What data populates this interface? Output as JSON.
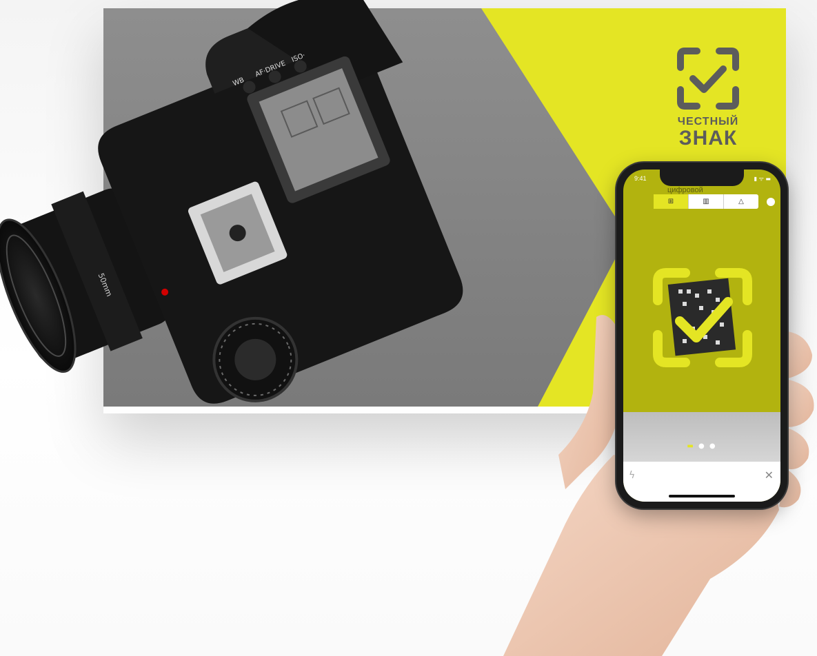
{
  "logo": {
    "line1": "ЧЕСТНЫЙ",
    "line2": "ЗНАК"
  },
  "camera": {
    "wb_label": "WB",
    "af_label": "AF·DRIVE",
    "iso_label": "ISO·",
    "lens_label": "50mm"
  },
  "phone": {
    "status_time": "9:41",
    "status_icons": "▮ ᯤ ▬",
    "screen_label": "цифровой",
    "segments": [
      {
        "icon": "datamatrix-icon",
        "glyph": "⊞"
      },
      {
        "icon": "barcode-icon",
        "glyph": "▥"
      },
      {
        "icon": "warning-icon",
        "glyph": "△"
      }
    ],
    "pager": {
      "active": "▬",
      "rest": "● ●"
    },
    "flash_glyph": "ϟ",
    "close_glyph": "✕"
  },
  "colors": {
    "brand_yellow": "#e4e524",
    "board_gray": "#808080",
    "logo_gray": "#5c5c5c",
    "screen_olive": "#b2b30f"
  }
}
